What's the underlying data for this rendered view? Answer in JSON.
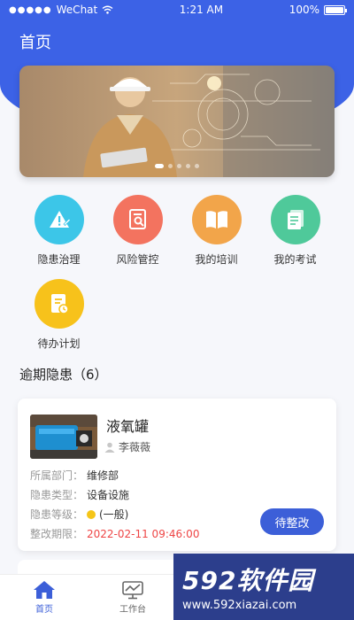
{
  "status_bar": {
    "carrier": "WeChat",
    "time": "1:21 AM",
    "battery": "100%"
  },
  "header": {
    "title": "首页"
  },
  "menu": [
    {
      "label": "隐患治理",
      "icon": "hazard-icon",
      "color": "#3cc6e8"
    },
    {
      "label": "风险管控",
      "icon": "risk-search-icon",
      "color": "#f3735f"
    },
    {
      "label": "我的培训",
      "icon": "book-icon",
      "color": "#f2a54a"
    },
    {
      "label": "我的考试",
      "icon": "exam-icon",
      "color": "#4fc99a"
    },
    {
      "label": "待办计划",
      "icon": "todo-plan-icon",
      "color": "#f7c21b"
    }
  ],
  "section": {
    "title": "逾期隐患（6）"
  },
  "card": {
    "name": "液氧罐",
    "user": "李薇薇",
    "rows": [
      {
        "label": "所属部门：",
        "value": "维修部"
      },
      {
        "label": "隐患类型：",
        "value": "设备设施"
      },
      {
        "label": "隐患等级：",
        "value": "(一般)"
      },
      {
        "label": "整改期限：",
        "value": "2022-02-11 09:46:00"
      }
    ],
    "status": "待整改",
    "level_color": "#f5c518"
  },
  "tabbar": [
    {
      "label": "首页",
      "icon": "home-icon"
    },
    {
      "label": "工作台",
      "icon": "workbench-icon"
    }
  ],
  "watermark": {
    "big": "592软件园",
    "small": "www.592xiazai.com"
  }
}
